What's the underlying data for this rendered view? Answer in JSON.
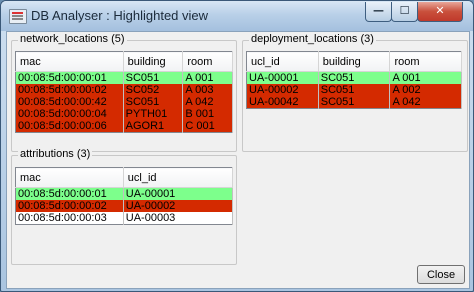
{
  "window": {
    "title": "DB Analyser : Highlighted view"
  },
  "colors": {
    "match": "#7dff8c",
    "conflict": "#d42a00",
    "normal": "#ffffff"
  },
  "network": {
    "title": "network_locations (5)",
    "columns": [
      "mac",
      "building",
      "room"
    ],
    "rows": [
      {
        "cells": [
          "00:08:5d:00:00:01",
          "SC051",
          "A 001"
        ],
        "status": "match"
      },
      {
        "cells": [
          "00:08:5d:00:00:02",
          "SC052",
          "A 003"
        ],
        "status": "conflict"
      },
      {
        "cells": [
          "00:08:5d:00:00:42",
          "SC051",
          "A 042"
        ],
        "status": "conflict"
      },
      {
        "cells": [
          "00:08:5d:00:00:04",
          "PYTH01",
          "B 001"
        ],
        "status": "conflict"
      },
      {
        "cells": [
          "00:08:5d:00:00:06",
          "AGOR1",
          "C 001"
        ],
        "status": "conflict"
      }
    ]
  },
  "deployment": {
    "title": "deployment_locations (3)",
    "columns": [
      "ucl_id",
      "building",
      "room"
    ],
    "rows": [
      {
        "cells": [
          "UA-00001",
          "SC051",
          "A 001"
        ],
        "status": "match"
      },
      {
        "cells": [
          "UA-00002",
          "SC051",
          "A 002"
        ],
        "status": "conflict"
      },
      {
        "cells": [
          "UA-00042",
          "SC051",
          "A 042"
        ],
        "status": "conflict"
      }
    ]
  },
  "attributions": {
    "title": "attributions (3)",
    "columns": [
      "mac",
      "ucl_id"
    ],
    "rows": [
      {
        "cells": [
          "00:08:5d:00:00:01",
          "UA-00001"
        ],
        "status": "match"
      },
      {
        "cells": [
          "00:08:5d:00:00:02",
          "UA-00002"
        ],
        "status": "conflict"
      },
      {
        "cells": [
          "00:08:5d:00:00:03",
          "UA-00003"
        ],
        "status": "normal"
      }
    ]
  },
  "buttons": {
    "close": "Close"
  },
  "icons": {
    "app": "database-table-icon",
    "minimize": "minimize-icon",
    "maximize": "maximize-icon",
    "close": "close-icon"
  }
}
